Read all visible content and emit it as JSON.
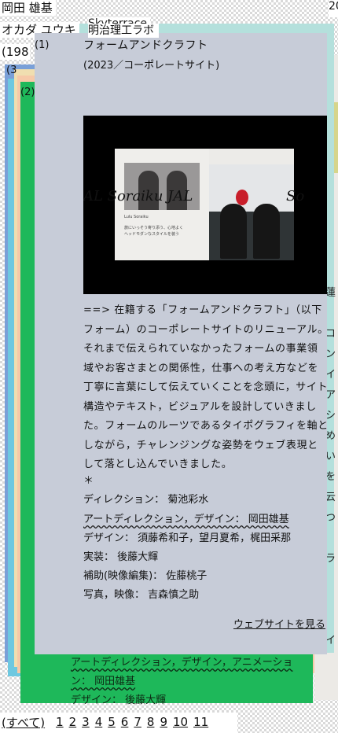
{
  "header": {
    "name": "岡田 雄基",
    "kana": "オカダ ユウキ",
    "year": "(198",
    "right_edge": "20"
  },
  "stack_labels": {
    "card3": "(3",
    "card2": "(2)"
  },
  "green_card": {
    "line1": "アートディレクション，デザイン，アニメーショ",
    "line2": "ン： 岡田雄基",
    "line3": "デザイン： 後藤大輝"
  },
  "right_column_fragments": [
    "蓮",
    "",
    "コ",
    "ン",
    "イ",
    "ア",
    "シ",
    "め",
    "い",
    "を",
    "云",
    "つ",
    "",
    "ラ",
    "",
    "",
    "",
    "イ"
  ],
  "main": {
    "number": "(1)",
    "client_overlay": "Skyterrace",
    "tag_overlay": "明治理工ラボ",
    "title": "フォームアンドクラフト",
    "subtitle": "(2023／コーポレートサイト)",
    "hero": {
      "small_caption_1": "Lulu Soraiku",
      "small_caption_2": "旅にいっそう寄り添う、心地よく",
      "small_caption_3": "ヘッドモダンなスタイルを装う",
      "wordmark_left": "AL Soraiku  JAL",
      "wordmark_right": "So"
    },
    "body": "==> 在籍する「フォームアンドクラフト」（以下フォーム）のコーポレートサイトのリニューアル。それまで伝えられていなかったフォームの事業領域やお客さまとの関係性，仕事への考え方などを丁寧に言葉にして伝えていくことを念頭に，サイト構造やテキスト，ビジュアルを設計していきました。フォームのルーツであるタイポグラフィを軸としながら，チャレンジングな姿勢をウェブ表現として落とし込んでいきました。",
    "separator": "＊",
    "credits": [
      "ディレクション： 菊池彩水",
      "アートディレクション，デザイン： 岡田雄基",
      "デザイン： 須藤希和子，望月夏希，梶田采那",
      "実装： 後藤大輝",
      "補助(映像編集)： 佐藤桃子",
      "写真，映像： 吉森慎之助"
    ],
    "view_link": "ウェブサイトを見る"
  },
  "pager": {
    "all": "(すべて)",
    "pages": [
      "1",
      "2",
      "3",
      "4",
      "5",
      "6",
      "7",
      "8",
      "9",
      "10",
      "11"
    ]
  }
}
